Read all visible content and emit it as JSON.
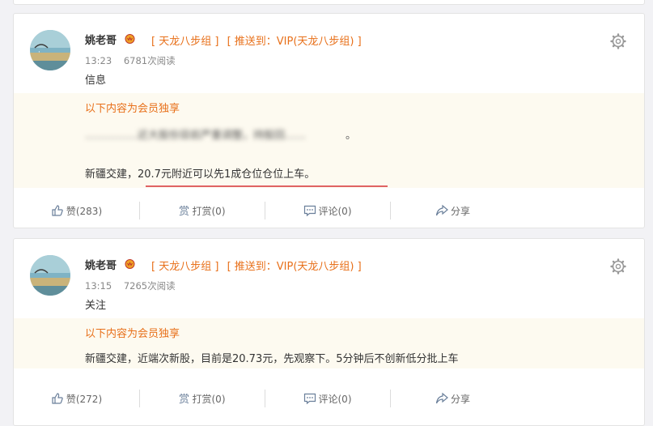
{
  "posts": [
    {
      "author": "姚老哥",
      "tags": [
        "[ 天龙八步组 ]",
        "[ 推送到：VIP(天龙八步组) ]"
      ],
      "time": "13:23",
      "reads": "6781次阅读",
      "title": "信息",
      "vip_notice": "以下内容为会员独享",
      "blurred_text": "……………近大股份目前严重调整，持股回……",
      "blurred_end": "。",
      "body": "新疆交建，20.7元附近可以先1成仓位仓位上车。",
      "actions": {
        "like": "赞(283)",
        "reward": "打赏(0)",
        "comment": "评论(0)",
        "share": "分享"
      }
    },
    {
      "author": "姚老哥",
      "tags": [
        "[ 天龙八步组 ]",
        "[ 推送到：VIP(天龙八步组) ]"
      ],
      "time": "13:15",
      "reads": "7265次阅读",
      "title": "关注",
      "vip_notice": "以下内容为会员独享",
      "body": "新疆交建，近端次新股，目前是20.73元，先观察下。5分钟后不创新低分批上车",
      "actions": {
        "like": "赞(272)",
        "reward": "打赏(0)",
        "comment": "评论(0)",
        "share": "分享"
      }
    }
  ],
  "colors": {
    "accent": "#e8701a",
    "vip_bg": "#fdfaf0",
    "underline": "#e06363",
    "page_bg": "#f2f2f5"
  },
  "icons": [
    "avatar-image",
    "vip-crown-icon",
    "gear-icon",
    "thumb-up-icon",
    "reward-icon",
    "comment-icon",
    "share-icon"
  ]
}
